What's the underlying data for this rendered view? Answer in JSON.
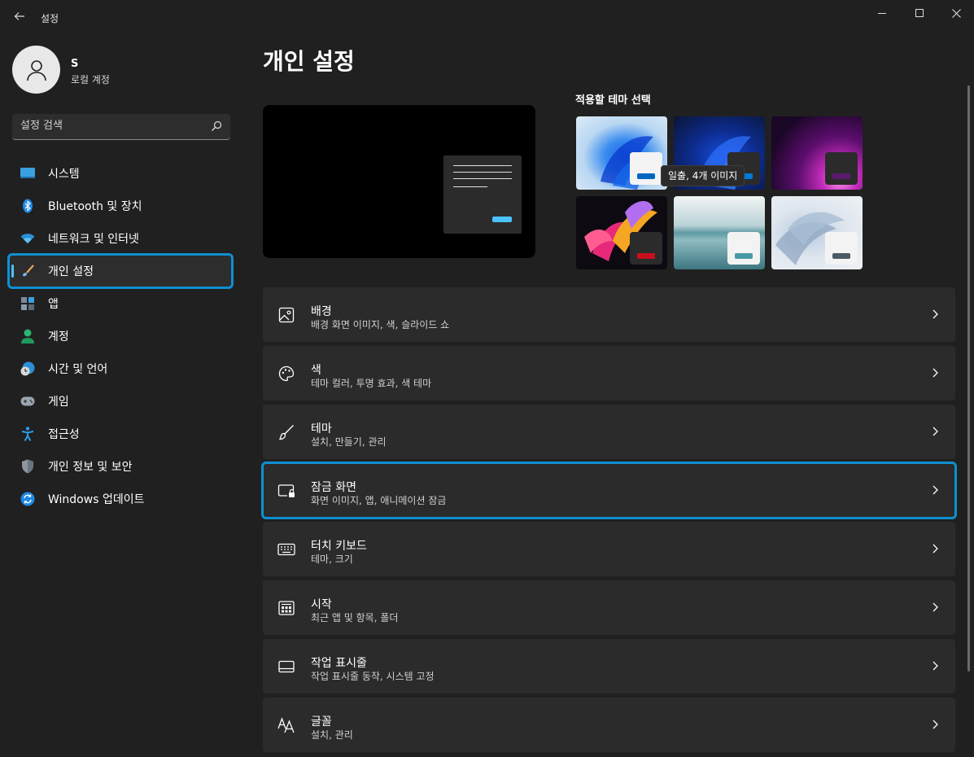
{
  "app": {
    "title": "설정"
  },
  "user": {
    "name": "S",
    "account_type": "로컬 계정"
  },
  "search": {
    "placeholder": "설정 검색"
  },
  "sidebar": {
    "items": [
      {
        "label": "시스템",
        "icon": "system-icon"
      },
      {
        "label": "Bluetooth 및 장치",
        "icon": "bluetooth-icon"
      },
      {
        "label": "네트워크 및 인터넷",
        "icon": "wifi-icon"
      },
      {
        "label": "개인 설정",
        "icon": "brush-icon",
        "active": true
      },
      {
        "label": "앱",
        "icon": "apps-icon"
      },
      {
        "label": "계정",
        "icon": "account-icon"
      },
      {
        "label": "시간 및 언어",
        "icon": "time-language-icon"
      },
      {
        "label": "게임",
        "icon": "gamepad-icon"
      },
      {
        "label": "접근성",
        "icon": "accessibility-icon"
      },
      {
        "label": "개인 정보 및 보안",
        "icon": "shield-icon"
      },
      {
        "label": "Windows 업데이트",
        "icon": "update-icon"
      }
    ]
  },
  "main": {
    "title": "개인 설정",
    "themes_title": "적용할 테마 선택",
    "tooltip": "일출, 4개 이미지",
    "themes": [
      {
        "name": "windows-light",
        "accent": "#0067c0"
      },
      {
        "name": "windows-dark",
        "accent": "#0078d4"
      },
      {
        "name": "glow",
        "accent": "#5b1a6e"
      },
      {
        "name": "captured-motion",
        "accent": "#c50f1f"
      },
      {
        "name": "sunrise",
        "accent": "#4a9aa6"
      },
      {
        "name": "flow",
        "accent": "#4b5a66"
      }
    ],
    "cards": [
      {
        "title": "배경",
        "subtitle": "배경 화면 이미지, 색, 슬라이드 쇼",
        "icon": "image-icon"
      },
      {
        "title": "색",
        "subtitle": "테마 컬러, 투명 효과, 색 테마",
        "icon": "palette-icon"
      },
      {
        "title": "테마",
        "subtitle": "설치, 만들기, 관리",
        "icon": "brush-icon"
      },
      {
        "title": "잠금 화면",
        "subtitle": "화면 이미지, 앱, 애니메이션 잠금",
        "icon": "lock-screen-icon"
      },
      {
        "title": "터치 키보드",
        "subtitle": "테마, 크기",
        "icon": "keyboard-icon"
      },
      {
        "title": "시작",
        "subtitle": "최근 앱 및 항목, 폴더",
        "icon": "start-icon"
      },
      {
        "title": "작업 표시줄",
        "subtitle": "작업 표시줄 동작, 시스템 고정",
        "icon": "taskbar-icon"
      },
      {
        "title": "글꼴",
        "subtitle": "설치, 관리",
        "icon": "fonts-icon"
      }
    ]
  },
  "colors": {
    "accent": "#4cc2ff",
    "highlight": "#0f8fd0"
  }
}
